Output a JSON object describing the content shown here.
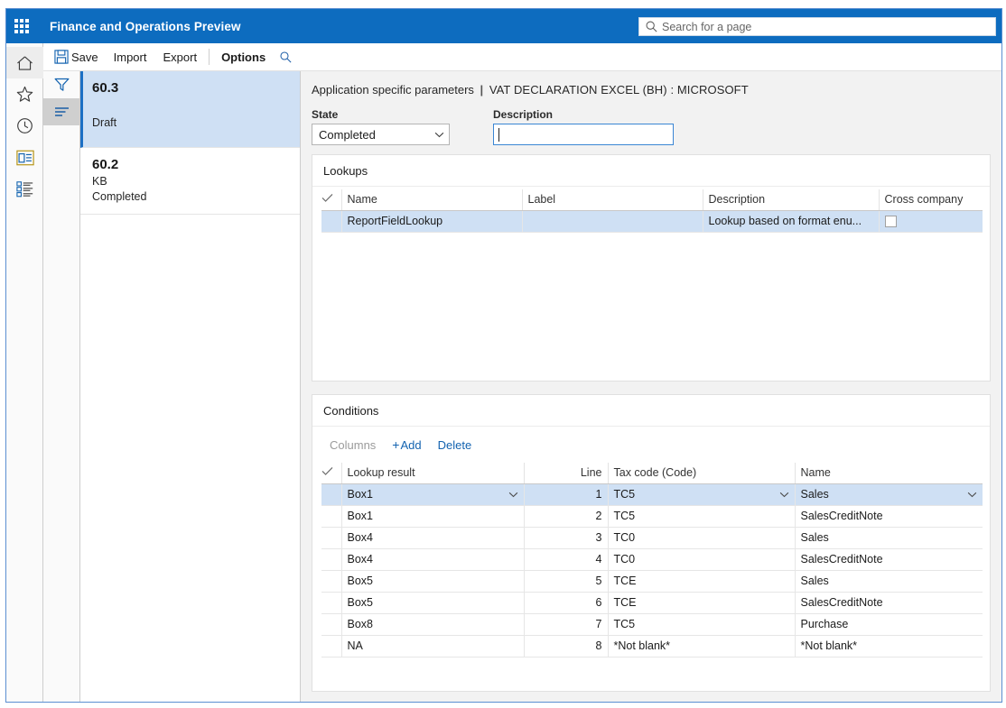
{
  "topbar": {
    "waffle_icon": "app-launcher-icon",
    "app_title": "Finance and Operations Preview",
    "search_icon": "search-icon",
    "search_placeholder": "Search for a page",
    "accent_color": "#0d6cbf"
  },
  "commandbar": {
    "hamburger_icon": "hamburger-menu-icon",
    "save_icon": "save-icon",
    "save_label": "Save",
    "import_label": "Import",
    "export_label": "Export",
    "options_label": "Options",
    "search_icon": "search-icon"
  },
  "rail": {
    "items": [
      {
        "icon": "home-icon",
        "name": "home"
      },
      {
        "icon": "star-icon",
        "name": "favorites"
      },
      {
        "icon": "clock-icon",
        "name": "recent"
      },
      {
        "icon": "workspace-icon",
        "name": "workspaces"
      },
      {
        "icon": "modules-list-icon",
        "name": "modules"
      }
    ]
  },
  "rail2": {
    "items": [
      {
        "icon": "filter-icon",
        "name": "filter",
        "active": false
      },
      {
        "icon": "list-lines-icon",
        "name": "list-view",
        "active": true
      }
    ]
  },
  "versions": [
    {
      "number": "60.3",
      "owner": "",
      "status": "Draft",
      "selected": true
    },
    {
      "number": "60.2",
      "owner": "KB",
      "status": "Completed",
      "selected": false
    }
  ],
  "page": {
    "breadcrumb_title": "Application specific parameters",
    "breadcrumb_sep": "|",
    "breadcrumb_context": "VAT DECLARATION EXCEL (BH) : MICROSOFT",
    "state_label": "State",
    "state_value": "Completed",
    "description_label": "Description",
    "description_value": "",
    "chevron_icon": "chevron-down-icon"
  },
  "lookups": {
    "title": "Lookups",
    "check_header_icon": "checkmark-icon",
    "columns": [
      "Name",
      "Label",
      "Description",
      "Cross company"
    ],
    "rows": [
      {
        "name": "ReportFieldLookup",
        "label": "",
        "description": "Lookup based on format enu...",
        "cross_company": false,
        "selected": true
      }
    ]
  },
  "conditions": {
    "title": "Conditions",
    "check_header_icon": "checkmark-icon",
    "toolbar": {
      "columns_label": "Columns",
      "add_label": "Add",
      "add_icon": "plus-icon",
      "delete_label": "Delete"
    },
    "columns": [
      "Lookup result",
      "Line",
      "Tax code (Code)",
      "Name"
    ],
    "rows": [
      {
        "lookup_result": "Box1",
        "line": "1",
        "tax_code": "TC5",
        "name": "Sales",
        "selected": true
      },
      {
        "lookup_result": "Box1",
        "line": "2",
        "tax_code": "TC5",
        "name": "SalesCreditNote",
        "selected": false
      },
      {
        "lookup_result": "Box4",
        "line": "3",
        "tax_code": "TC0",
        "name": "Sales",
        "selected": false
      },
      {
        "lookup_result": "Box4",
        "line": "4",
        "tax_code": "TC0",
        "name": "SalesCreditNote",
        "selected": false
      },
      {
        "lookup_result": "Box5",
        "line": "5",
        "tax_code": "TCE",
        "name": "Sales",
        "selected": false
      },
      {
        "lookup_result": "Box5",
        "line": "6",
        "tax_code": "TCE",
        "name": "SalesCreditNote",
        "selected": false
      },
      {
        "lookup_result": "Box8",
        "line": "7",
        "tax_code": "TC5",
        "name": "Purchase",
        "selected": false
      },
      {
        "lookup_result": "NA",
        "line": "8",
        "tax_code": "*Not blank*",
        "name": "*Not blank*",
        "selected": false
      }
    ]
  }
}
